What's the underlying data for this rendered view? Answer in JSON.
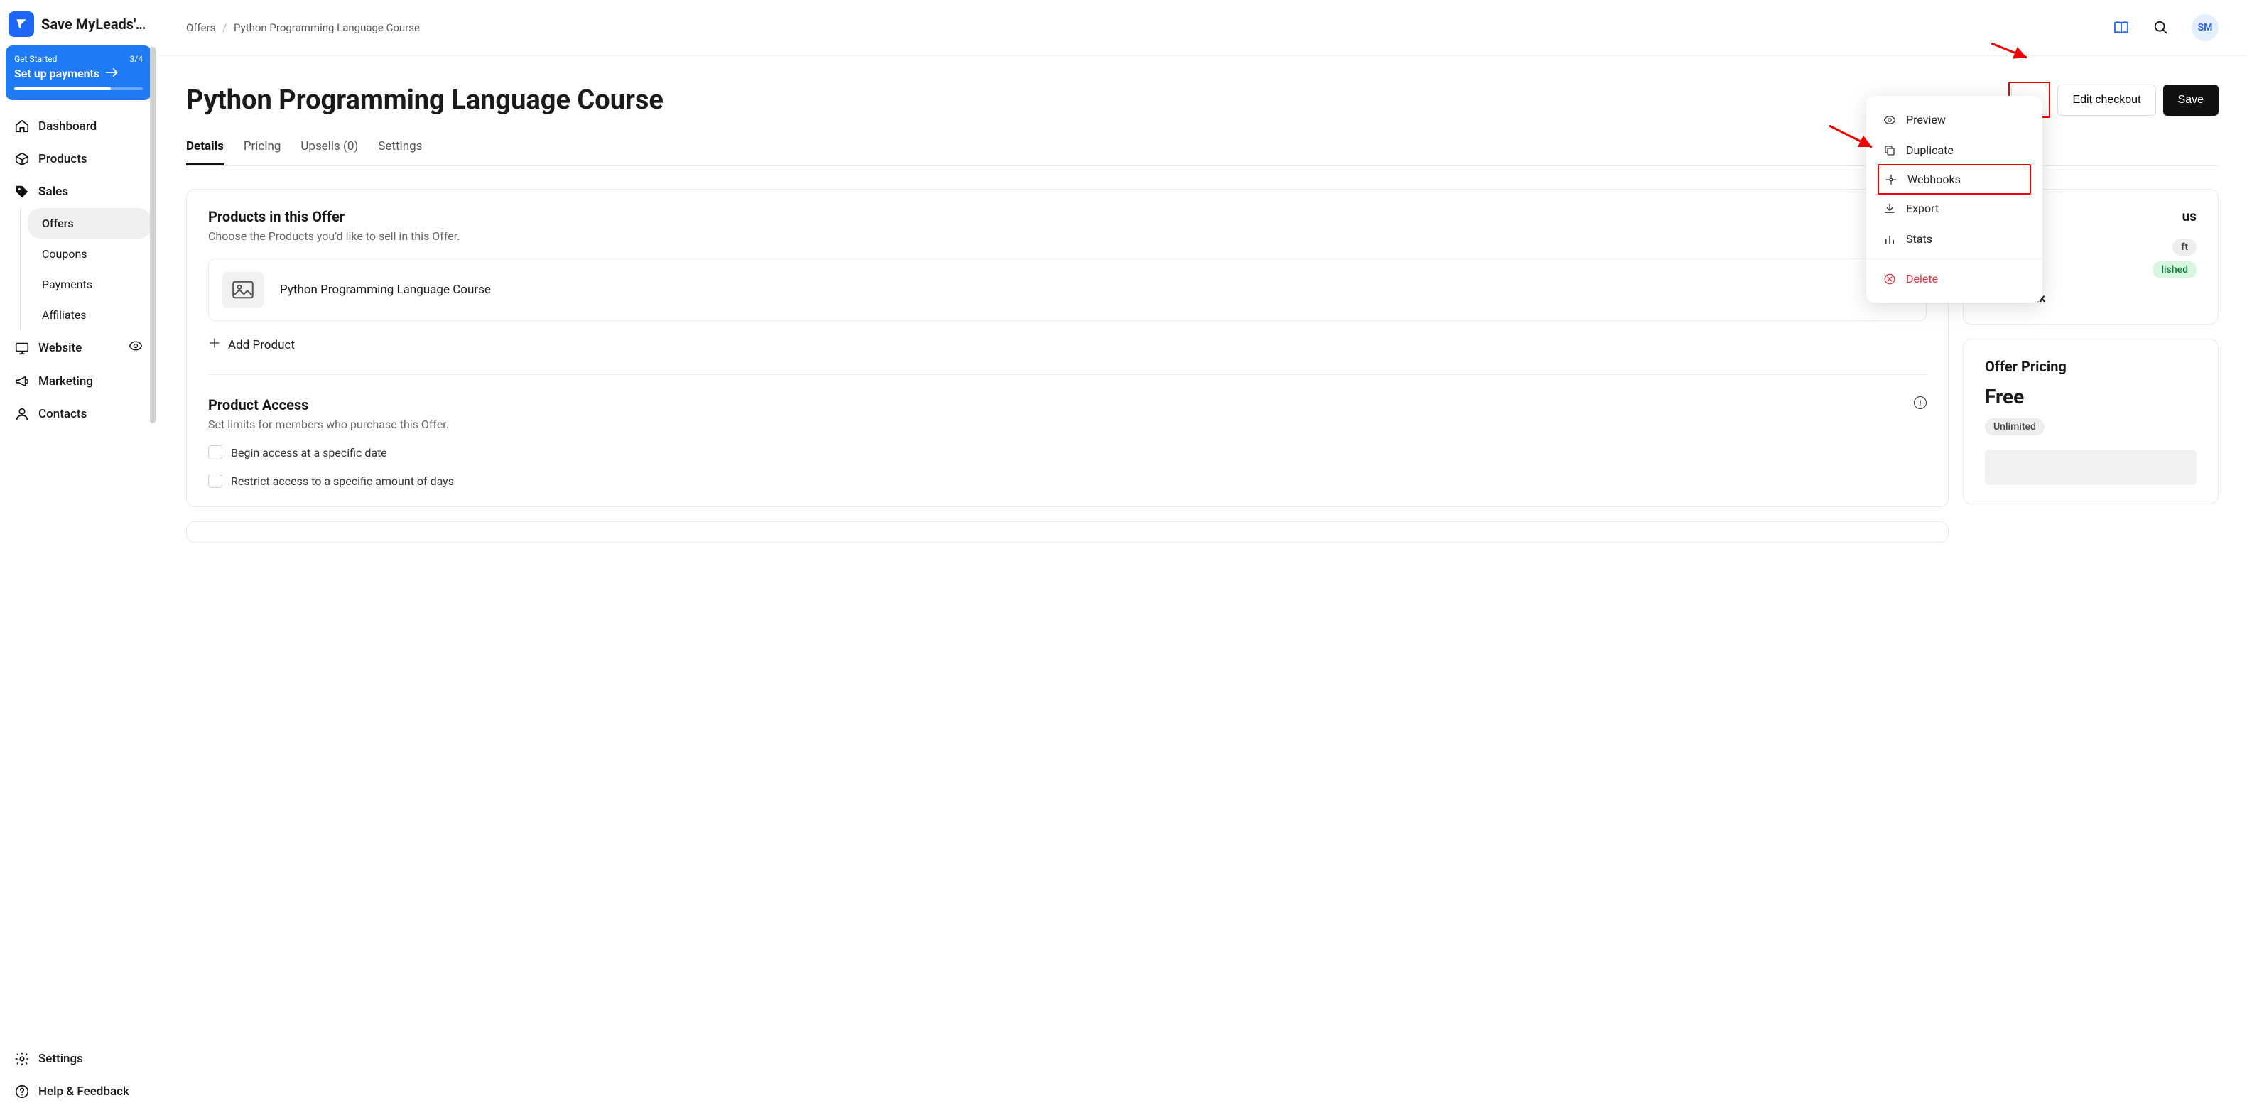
{
  "app": {
    "title": "Save MyLeads's F…"
  },
  "get_started": {
    "label": "Get Started",
    "progress_text": "3/4",
    "cta": "Set up payments",
    "progress_pct": 75
  },
  "nav": {
    "dashboard": "Dashboard",
    "products": "Products",
    "sales": "Sales",
    "sales_sub": {
      "offers": "Offers",
      "coupons": "Coupons",
      "payments": "Payments",
      "affiliates": "Affiliates"
    },
    "website": "Website",
    "marketing": "Marketing",
    "contacts": "Contacts",
    "settings": "Settings",
    "help": "Help & Feedback"
  },
  "breadcrumbs": {
    "root": "Offers",
    "current": "Python Programming Language Course"
  },
  "header": {
    "title": "Python Programming Language Course",
    "edit_checkout": "Edit checkout",
    "save": "Save",
    "more_dots": "•••"
  },
  "tabs": {
    "details": "Details",
    "pricing": "Pricing",
    "upsells": "Upsells (0)",
    "settings": "Settings"
  },
  "products_card": {
    "title": "Products in this Offer",
    "sub": "Choose the Products you'd like to sell in this Offer.",
    "product_name": "Python Programming Language Course",
    "add": "Add Product"
  },
  "access_card": {
    "title": "Product Access",
    "sub": "Set limits for members who purchase this Offer.",
    "opt_begin": "Begin access at a specific date",
    "opt_restrict": "Restrict access to a specific amount of days"
  },
  "status_card": {
    "title_suffix": "us",
    "draft_suffix": "ft",
    "published_suffix": "lished",
    "get_link": "Get Link"
  },
  "pricing_card": {
    "title": "Offer Pricing",
    "price": "Free",
    "badge": "Unlimited"
  },
  "dropdown": {
    "preview": "Preview",
    "duplicate": "Duplicate",
    "webhooks": "Webhooks",
    "export": "Export",
    "stats": "Stats",
    "delete": "Delete"
  },
  "avatar": "SM"
}
